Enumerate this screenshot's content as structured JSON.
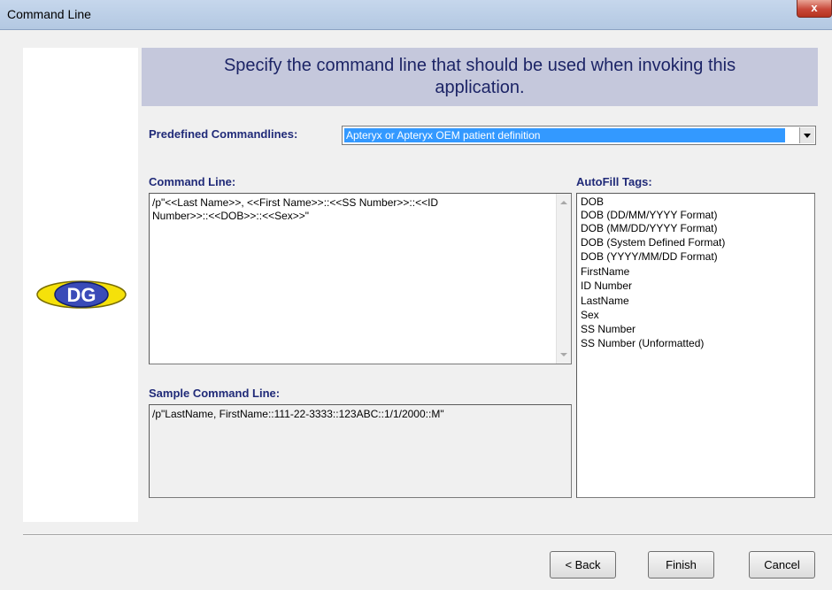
{
  "window": {
    "title": "Command Line",
    "close_glyph": "x"
  },
  "header": {
    "text_line1": "Specify the command line that should be used when invoking this",
    "text_line2": "application."
  },
  "logo": {
    "text": "DG"
  },
  "predefined": {
    "label": "Predefined Commandlines:",
    "selected": "Apteryx or Apteryx OEM patient definition"
  },
  "command_line": {
    "label": "Command Line:",
    "line1": "/p\"<<Last Name>>, <<First Name>>::<<SS Number>>::<<ID",
    "line2": "Number>>::<<DOB>>::<<Sex>>\""
  },
  "sample": {
    "label": "Sample Command Line:",
    "value": "/p\"LastName, FirstName::111-22-3333::123ABC::1/1/2000::M\""
  },
  "autofill": {
    "label": "AutoFill Tags:",
    "items": [
      "DOB",
      "DOB (DD/MM/YYYY Format)",
      "DOB (MM/DD/YYYY Format)",
      "DOB (System Defined Format)",
      "DOB (YYYY/MM/DD Format)",
      "FirstName",
      "ID Number",
      "LastName",
      "Sex",
      "SS Number",
      "SS Number (Unformatted)"
    ]
  },
  "buttons": {
    "back": "< Back",
    "finish": "Finish",
    "cancel": "Cancel"
  }
}
